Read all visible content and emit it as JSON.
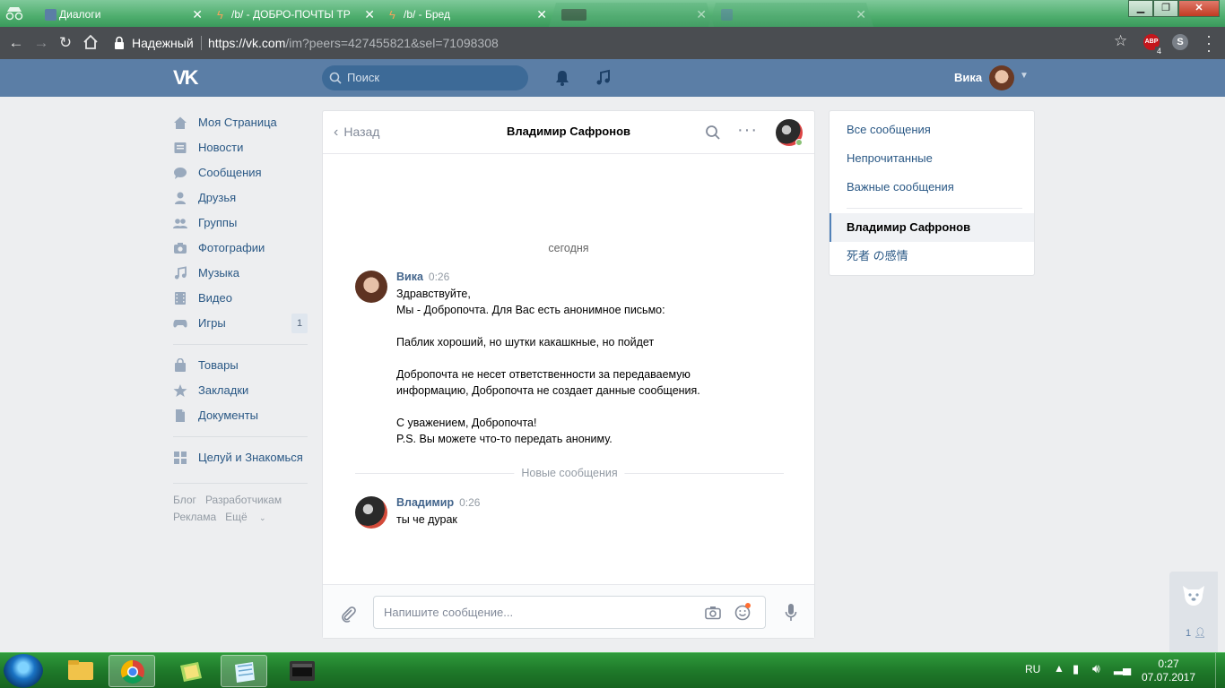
{
  "browser": {
    "tabs": [
      {
        "title": "Диалоги",
        "active": true
      },
      {
        "title": "/b/ - ДОБРО-ПОЧТЫ ТР",
        "active": false
      },
      {
        "title": "/b/ - Бред",
        "active": false
      },
      {
        "title": "",
        "active": false
      },
      {
        "title": "",
        "active": false
      }
    ],
    "secure_label": "Надежный",
    "url_host": "https://vk.com",
    "url_path": "/im?peers=427455821&sel=71098308",
    "ext_abp_label": "ABP",
    "ext_abp_badge": "4",
    "colors": {
      "frame": "#4fae6e",
      "toolbar": "#4a4d51"
    }
  },
  "vk": {
    "search_placeholder": "Поиск",
    "user_name": "Вика",
    "colors": {
      "header": "#5b7ea6",
      "link": "#2a5885",
      "author": "#42648b"
    }
  },
  "leftnav": {
    "items": [
      {
        "label": "Моя Страница",
        "icon": "home-icon"
      },
      {
        "label": "Новости",
        "icon": "news-icon"
      },
      {
        "label": "Сообщения",
        "icon": "messages-icon"
      },
      {
        "label": "Друзья",
        "icon": "friends-icon"
      },
      {
        "label": "Группы",
        "icon": "groups-icon"
      },
      {
        "label": "Фотографии",
        "icon": "camera-icon"
      },
      {
        "label": "Музыка",
        "icon": "music-icon"
      },
      {
        "label": "Видео",
        "icon": "video-icon"
      },
      {
        "label": "Игры",
        "icon": "gamepad-icon",
        "count": "1"
      }
    ],
    "items2": [
      {
        "label": "Товары",
        "icon": "bag-icon"
      },
      {
        "label": "Закладки",
        "icon": "star-icon"
      },
      {
        "label": "Документы",
        "icon": "document-icon"
      }
    ],
    "items3": [
      {
        "label": "Целуй и Знакомься",
        "icon": "app-grid-icon"
      }
    ],
    "footer": [
      "Блог",
      "Разработчикам",
      "Реклама",
      "Ещё"
    ]
  },
  "chat": {
    "back_label": "Назад",
    "peer_name": "Владимир Сафронов",
    "day_label": "сегодня",
    "new_messages_label": "Новые сообщения",
    "messages": [
      {
        "author": "Вика",
        "time": "0:26",
        "lines": [
          "Здравствуйте,",
          "Мы - Добропочта. Для Вас есть анонимное письмо:",
          "",
          "Паблик хороший, но шутки какашкные, но пойдет",
          "",
          "Добропочта не несет ответственности за передаваемую",
          "информацию, Добропочта не создает данные сообщения.",
          "",
          "С уважением, Добропочта!",
          "P.S. Вы можете что-то передать анониму."
        ]
      },
      {
        "author": "Владимир",
        "time": "0:26",
        "lines": [
          "ты че дурак"
        ]
      }
    ],
    "composer_placeholder": "Напишите сообщение..."
  },
  "rightmenu": {
    "items": [
      {
        "label": "Все сообщения"
      },
      {
        "label": "Непрочитанные"
      },
      {
        "label": "Важные сообщения"
      }
    ],
    "dialogs": [
      {
        "label": "Владимир Сафронов",
        "selected": true
      },
      {
        "label": "死者 の感情",
        "selected": false
      }
    ]
  },
  "widget": {
    "count": "1"
  },
  "taskbar": {
    "lang": "RU",
    "time": "0:27",
    "date": "07.07.2017"
  }
}
